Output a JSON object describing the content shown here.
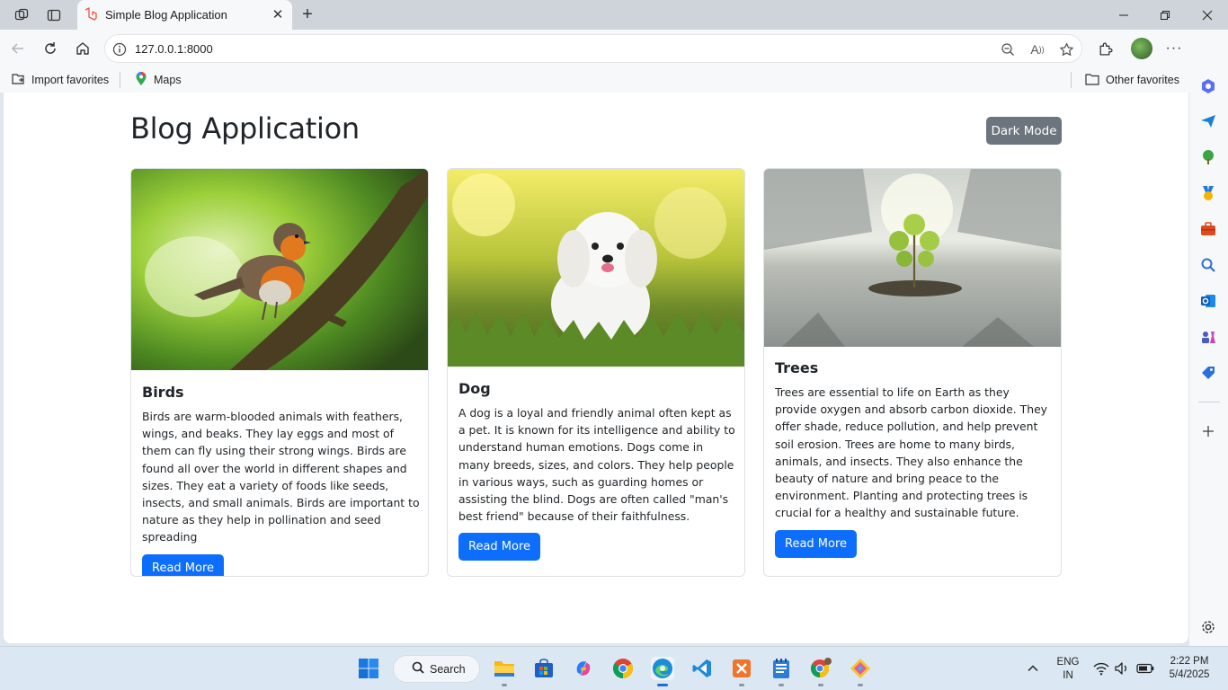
{
  "browser": {
    "tab_title": "Simple Blog Application",
    "url": "127.0.0.1:8000",
    "favorites": [
      "Import favorites",
      "Maps"
    ],
    "other_favorites": "Other favorites"
  },
  "page": {
    "title": "Blog Application",
    "dark_mode_label": "Dark Mode",
    "posts": [
      {
        "title": "Birds",
        "body": "Birds are warm-blooded animals with feathers, wings, and beaks. They lay eggs and most of them can fly using their strong wings. Birds are found all over the world in different shapes and sizes. They eat a variety of foods like seeds, insects, and small animals. Birds are important to nature as they help in pollination and seed spreading",
        "button": "Read More"
      },
      {
        "title": "Dog",
        "body": "A dog is a loyal and friendly animal often kept as a pet. It is known for its intelligence and ability to understand human emotions. Dogs come in many breeds, sizes, and colors. They help people in various ways, such as guarding homes or assisting the blind. Dogs are often called \"man's best friend\" because of their faithfulness.",
        "button": "Read More"
      },
      {
        "title": "Trees",
        "body": "Trees are essential to life on Earth as they provide oxygen and absorb carbon dioxide. They offer shade, reduce pollution, and help prevent soil erosion. Trees are home to many birds, animals, and insects. They also enhance the beauty of nature and bring peace to the environment. Planting and protecting trees is crucial for a healthy and sustainable future.",
        "button": "Read More"
      }
    ]
  },
  "taskbar": {
    "search_label": "Search",
    "lang_line1": "ENG",
    "lang_line2": "IN",
    "time": "2:22 PM",
    "date": "5/4/2025"
  },
  "colors": {
    "primary": "#0d6efd",
    "secondary": "#6c757d",
    "text": "#212529"
  }
}
